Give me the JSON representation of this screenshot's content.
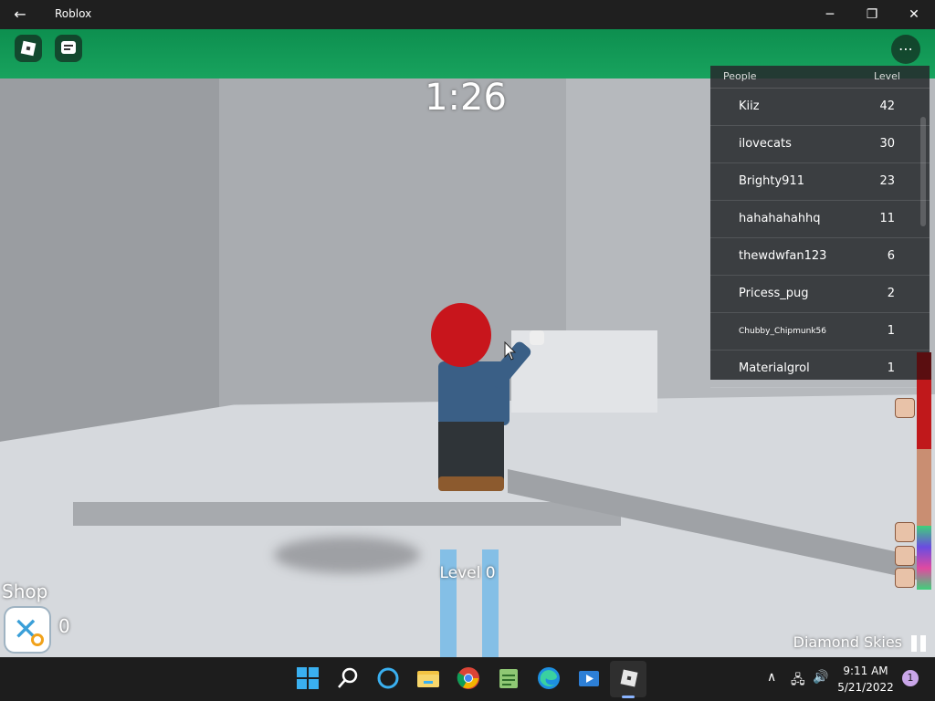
{
  "window": {
    "title": "Roblox",
    "back_icon": "back-arrow-icon",
    "minimize_glyph": "─",
    "maximize_glyph": "❐",
    "close_glyph": "✕"
  },
  "hud": {
    "timer": "1:26",
    "roblox_menu_icon": "roblox-logo-icon",
    "chat_icon": "chat-icon",
    "more_icon": "more-options-icon",
    "more_glyph": "⋯"
  },
  "leaderboard": {
    "headers": {
      "people": "People",
      "level": "Level"
    },
    "rows": [
      {
        "name": "Kiiz",
        "level": "42"
      },
      {
        "name": "ilovecats",
        "level": "30"
      },
      {
        "name": "Brighty911",
        "level": "23"
      },
      {
        "name": "hahahahahhq",
        "level": "11"
      },
      {
        "name": "thewdwfan123",
        "level": "6"
      },
      {
        "name": "Pricess_pug",
        "level": "2"
      },
      {
        "name": "Chubby_Chipmunk56",
        "level": "1"
      },
      {
        "name": "Materialgrol",
        "level": "1"
      }
    ]
  },
  "game": {
    "level_text": "Level 0",
    "shop_label": "Shop",
    "shop_count": "0",
    "map_name": "Diamond Skies",
    "shop_icon": "shop-icon"
  },
  "colors": {
    "roof_green": "#0d8f4f",
    "hat_red": "#c8151c",
    "progress_red": "#c0181b"
  },
  "taskbar": {
    "icons": [
      "windows-start-icon",
      "search-icon",
      "cortana-icon",
      "file-explorer-icon",
      "chrome-icon",
      "notepad-icon",
      "edge-icon",
      "movies-tv-icon",
      "roblox-icon"
    ],
    "tray": {
      "chevron_glyph": "∧",
      "network_glyph": "🖧",
      "volume_glyph": "🔊"
    },
    "time": "9:11 AM",
    "date": "5/21/2022",
    "notifications": "1"
  }
}
